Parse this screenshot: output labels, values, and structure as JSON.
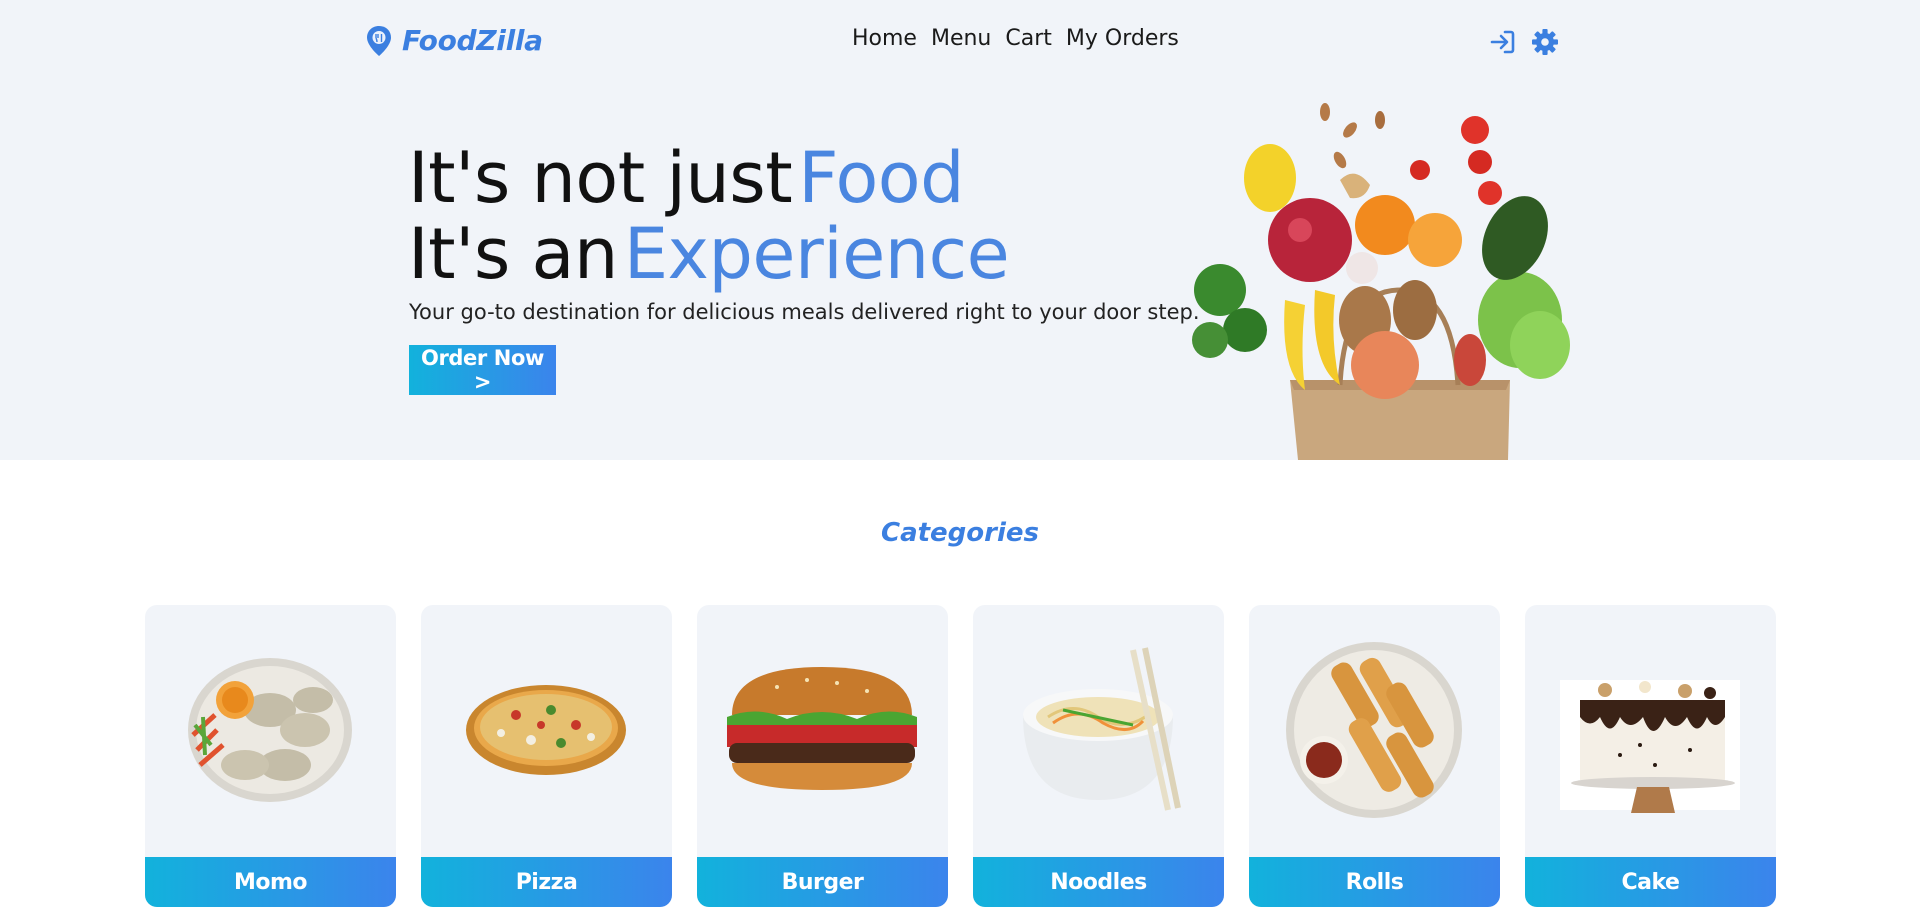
{
  "brand": {
    "name": "FoodZilla",
    "accent_color": "#3b7fe0",
    "logo_icon": "map-pin-icon"
  },
  "nav": {
    "links": [
      {
        "label": "Home"
      },
      {
        "label": "Menu"
      },
      {
        "label": "Cart"
      },
      {
        "label": "My Orders"
      }
    ],
    "icons": [
      "login-icon",
      "gear-icon"
    ]
  },
  "hero": {
    "line1_prefix": "It's not just",
    "line1_accent": "Food",
    "line2_prefix": "It's an",
    "line2_accent": "Experience",
    "tagline": "Your go-to destination for delicious meals delivered right to your door step.",
    "cta_label": "Order Now >",
    "image": "grocery-bag-with-fruits-and-vegetables"
  },
  "categories": {
    "title": "Categories",
    "items": [
      {
        "label": "Momo",
        "image": "momo-plate"
      },
      {
        "label": "Pizza",
        "image": "pizza"
      },
      {
        "label": "Burger",
        "image": "burger"
      },
      {
        "label": "Noodles",
        "image": "noodles-bowl-with-chopsticks"
      },
      {
        "label": "Rolls",
        "image": "spring-rolls-plate"
      },
      {
        "label": "Cake",
        "image": "chocolate-drip-cake"
      }
    ]
  },
  "colors": {
    "hero_bg": "#f1f4f9",
    "accent": "#4a86e0",
    "button_gradient_start": "#12b2dc",
    "button_gradient_end": "#3b84ec"
  }
}
